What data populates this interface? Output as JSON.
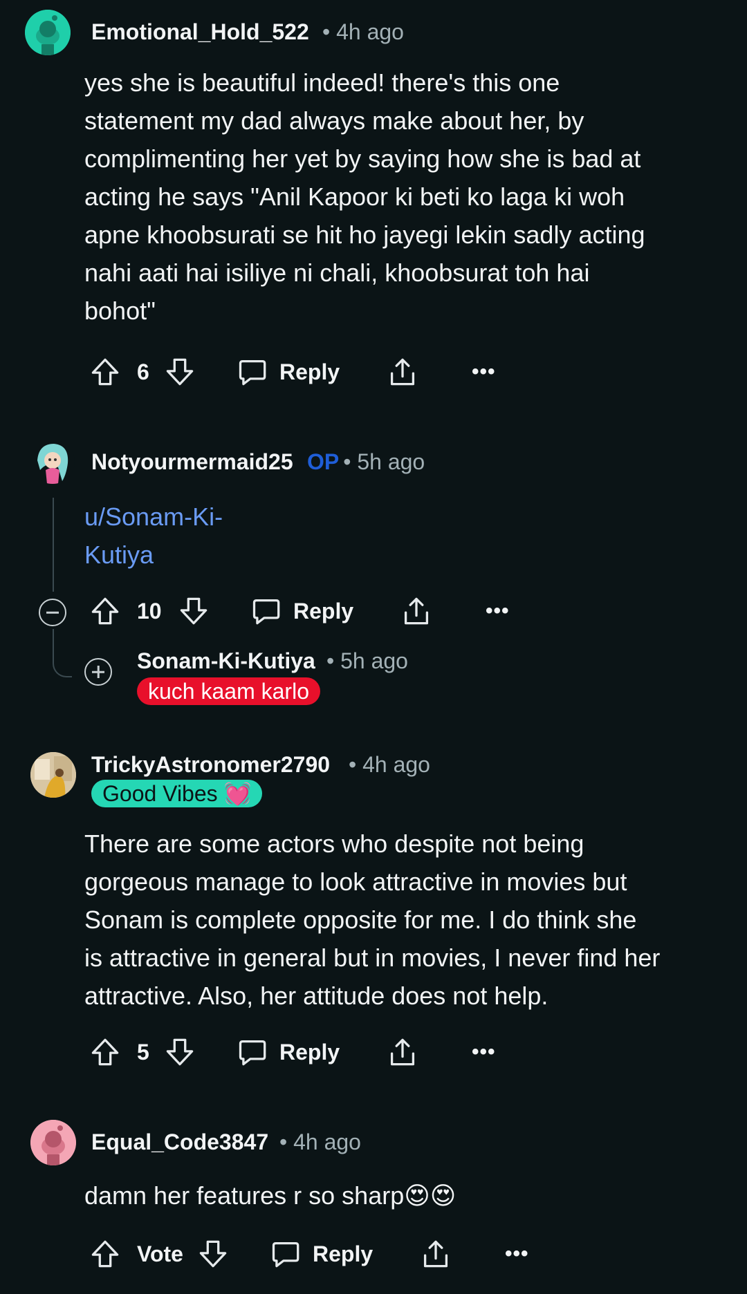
{
  "comments": [
    {
      "username": "Emotional_Hold_522",
      "time": "4h ago",
      "avatar_color": "#1fcfaa",
      "body": "yes she is beautiful indeed! there's this one\nstatement my dad always make about her, by\ncomplimenting her yet by saying how she is bad at\nacting he says \"Anil Kapoor ki beti ko laga ki woh\napne khoobsurati se hit ho jayegi lekin sadly acting\nnahi aati hai isiliye ni chali, khoobsurat toh hai\nbohot\"",
      "votes": "6",
      "reply_label": "Reply"
    },
    {
      "username": "Notyourmermaid25",
      "op_badge": "OP",
      "time": "5h ago",
      "body": "u/Sonam-Ki-\nKutiya",
      "votes": "10",
      "reply_label": "Reply"
    },
    {
      "username": "Sonam-Ki-Kutiya",
      "time": "5h ago",
      "flair": "kuch kaam karlo",
      "flair_color": "#e8102b"
    },
    {
      "username": "TrickyAstronomer2790",
      "time": "4h ago",
      "flair": "Good Vibes 💓",
      "flair_color": "#25d7b4",
      "body": "There are some actors who despite not being\ngorgeous manage to look attractive in movies but\nSonam is complete opposite for me. I do think she\nis attractive in general but in movies, I never find her\nattractive. Also, her attitude does not help.",
      "votes": "5",
      "reply_label": "Reply"
    },
    {
      "username": "Equal_Code3847",
      "time": "4h ago",
      "avatar_color": "#f4a6b5",
      "body": "damn her features r so sharp😍😍",
      "votes": "Vote",
      "reply_label": "Reply"
    }
  ],
  "icons": {
    "upvote": "upvote-icon",
    "downvote": "downvote-icon",
    "reply": "comment-bubble-icon",
    "share": "share-icon",
    "more": "more-options-icon",
    "collapse": "collapse-thread-icon",
    "expand": "expand-thread-icon"
  },
  "more_glyph": "•••",
  "separator": "•"
}
